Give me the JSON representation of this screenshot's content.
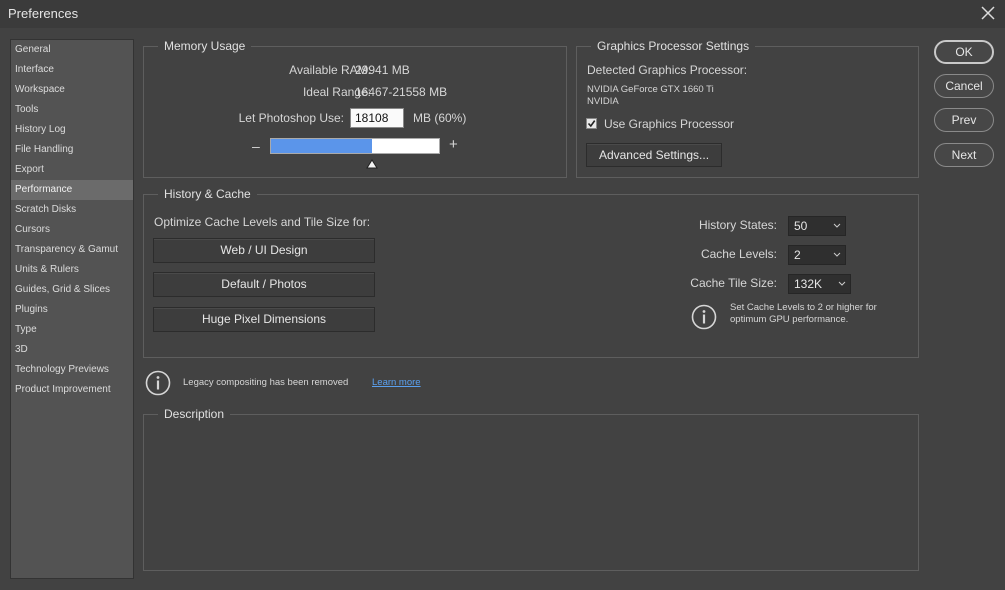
{
  "window": {
    "title": "Preferences"
  },
  "sidebar": {
    "items": [
      {
        "label": "General"
      },
      {
        "label": "Interface"
      },
      {
        "label": "Workspace"
      },
      {
        "label": "Tools"
      },
      {
        "label": "History Log"
      },
      {
        "label": "File Handling"
      },
      {
        "label": "Export"
      },
      {
        "label": "Performance"
      },
      {
        "label": "Scratch Disks"
      },
      {
        "label": "Cursors"
      },
      {
        "label": "Transparency & Gamut"
      },
      {
        "label": "Units & Rulers"
      },
      {
        "label": "Guides, Grid & Slices"
      },
      {
        "label": "Plugins"
      },
      {
        "label": "Type"
      },
      {
        "label": "3D"
      },
      {
        "label": "Technology Previews"
      },
      {
        "label": "Product Improvement"
      }
    ],
    "active_index": 7
  },
  "memory": {
    "legend": "Memory Usage",
    "available_label": "Available RAM:",
    "available_value": "29941 MB",
    "ideal_label": "Ideal Range:",
    "ideal_value": "16467-21558 MB",
    "use_label": "Let Photoshop Use:",
    "use_value": "18108",
    "use_suffix": "MB (60%)",
    "slider_percent": 60,
    "minus": "–",
    "plus": "+"
  },
  "gpu": {
    "legend": "Graphics Processor Settings",
    "detected_label": "Detected Graphics Processor:",
    "line1": "NVIDIA GeForce GTX 1660 Ti",
    "line2": "NVIDIA",
    "use_label": "Use Graphics Processor",
    "use_checked": true,
    "advanced_label": "Advanced Settings..."
  },
  "history_cache": {
    "legend": "History & Cache",
    "optimize_label": "Optimize Cache Levels and Tile Size for:",
    "web_btn": "Web / UI Design",
    "default_btn": "Default / Photos",
    "huge_btn": "Huge Pixel Dimensions",
    "history_states_label": "History States:",
    "history_states_value": "50",
    "cache_levels_label": "Cache Levels:",
    "cache_levels_value": "2",
    "tile_size_label": "Cache Tile Size:",
    "tile_size_value": "132K",
    "note_line1": "Set Cache Levels to 2 or higher for",
    "note_line2": "optimum GPU performance."
  },
  "legacy": {
    "text": "Legacy compositing has been removed",
    "link": "Learn more"
  },
  "description": {
    "legend": "Description"
  },
  "actions": {
    "ok": "OK",
    "cancel": "Cancel",
    "prev": "Prev",
    "next": "Next"
  },
  "colors": {
    "accent": "#5b95ea",
    "link": "#5aa0ef"
  }
}
